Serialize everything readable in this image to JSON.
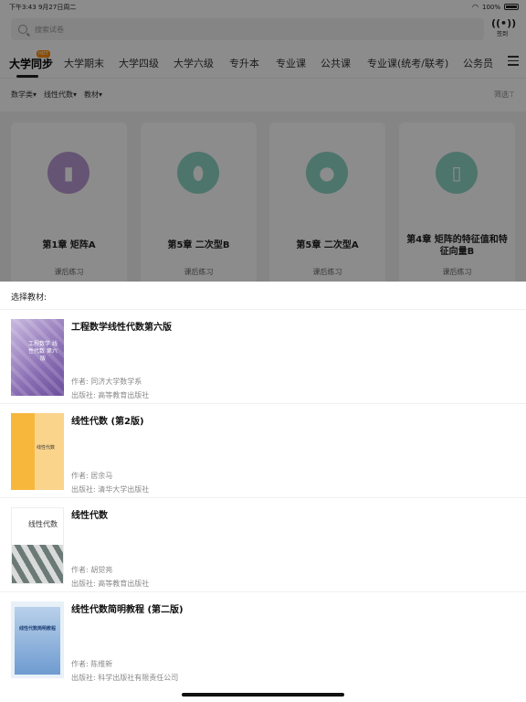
{
  "status_bar": {
    "time": "下午3:43",
    "date": "9月27日周二",
    "battery": "100%"
  },
  "search": {
    "placeholder": "搜索试卷"
  },
  "signin": {
    "label": "签到"
  },
  "tabs": {
    "items": [
      "大学同步",
      "大学期末",
      "大学四级",
      "大学六级",
      "专升本",
      "专业课",
      "公共课",
      "专业课(统考/联考)",
      "公务员"
    ],
    "active_index": 0,
    "badge": "HOT"
  },
  "filters": {
    "items": [
      "数学类▾",
      "线性代数▾",
      "教材▾"
    ],
    "screen": "筛选⊤"
  },
  "cards": [
    {
      "title": "第1章  矩阵A",
      "subtitle": "课后练习",
      "icon": "bottle-icon",
      "color": "#b99ad2"
    },
    {
      "title": "第5章  二次型B",
      "subtitle": "课后练习",
      "icon": "football-icon",
      "color": "#8dd6c4"
    },
    {
      "title": "第5章  二次型A",
      "subtitle": "课后练习",
      "icon": "ball-icon",
      "color": "#8dd6c4"
    },
    {
      "title": "第4章  矩阵的特征值和特征向量B",
      "subtitle": "课后练习",
      "icon": "cup-icon",
      "color": "#8dd6c4"
    }
  ],
  "sheet": {
    "title": "选择教材:",
    "books": [
      {
        "title": "工程数学线性代数第六版",
        "author": "作者: 同济大学数学系",
        "publisher": "出版社: 高等教育出版社",
        "cover_text": "工程数学 线性代数 第六版"
      },
      {
        "title": "线性代数 (第2版)",
        "author": "作者: 居余马",
        "publisher": "出版社: 清华大学出版社",
        "cover_text": "线性代数"
      },
      {
        "title": "线性代数",
        "author": "作者: 胡觉亮",
        "publisher": "出版社: 高等教育出版社",
        "cover_text": "线性代数"
      },
      {
        "title": "线性代数简明教程 (第二版)",
        "author": "作者: 陈维新",
        "publisher": "出版社: 科学出版社有限责任公司",
        "cover_text": "线性代数简明教程"
      }
    ]
  }
}
